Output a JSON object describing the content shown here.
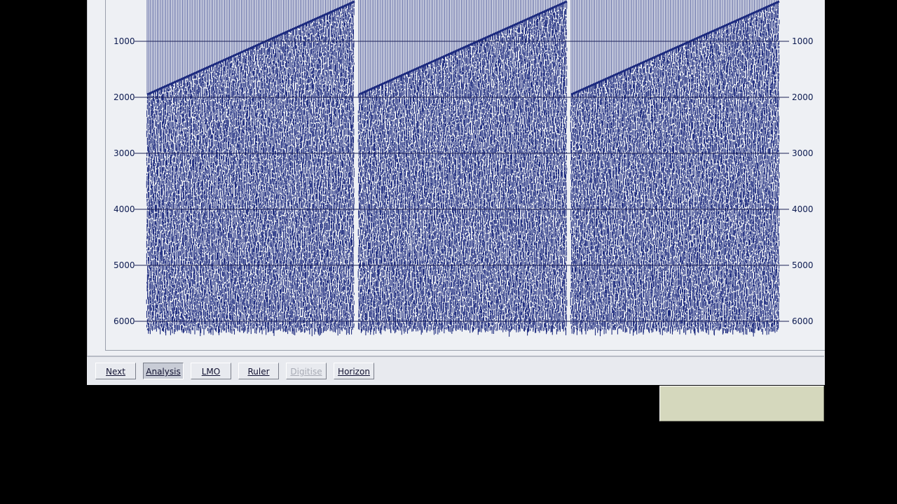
{
  "plot": {
    "y_ticks": [
      "1000",
      "2000",
      "3000",
      "4000",
      "5000",
      "6000"
    ],
    "trace_color": "#1c2a7e",
    "grid_color": "#1a1f55",
    "background": "#eef0f4"
  },
  "toolbar": {
    "buttons": [
      {
        "label": "Next",
        "state": "normal"
      },
      {
        "label": "Analysis",
        "state": "active"
      },
      {
        "label": "LMO",
        "state": "normal"
      },
      {
        "label": "Ruler",
        "state": "normal"
      },
      {
        "label": "Digitise",
        "state": "disabled"
      },
      {
        "label": "Horizon",
        "state": "normal"
      }
    ]
  }
}
